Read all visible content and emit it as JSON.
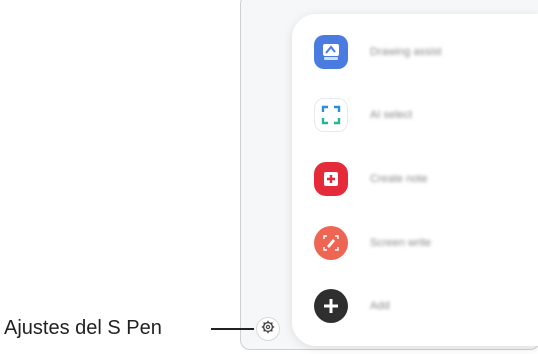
{
  "callout": {
    "label": "Ajustes del S Pen"
  },
  "air_command": {
    "items": [
      {
        "label": "Drawing assist",
        "icon": "drawing-assist-icon"
      },
      {
        "label": "AI select",
        "icon": "ai-select-icon"
      },
      {
        "label": "Create note",
        "icon": "create-note-icon"
      },
      {
        "label": "Screen write",
        "icon": "screen-write-icon"
      },
      {
        "label": "Add",
        "icon": "plus-icon"
      }
    ],
    "settings_icon": "gear-icon"
  },
  "colors": {
    "drawing_assist": "#4a7be0",
    "ai_select_accent": "#2d8fd5",
    "create_note": "#e52b3a",
    "screen_write": "#ef6553",
    "add": "#2f2f2f"
  }
}
